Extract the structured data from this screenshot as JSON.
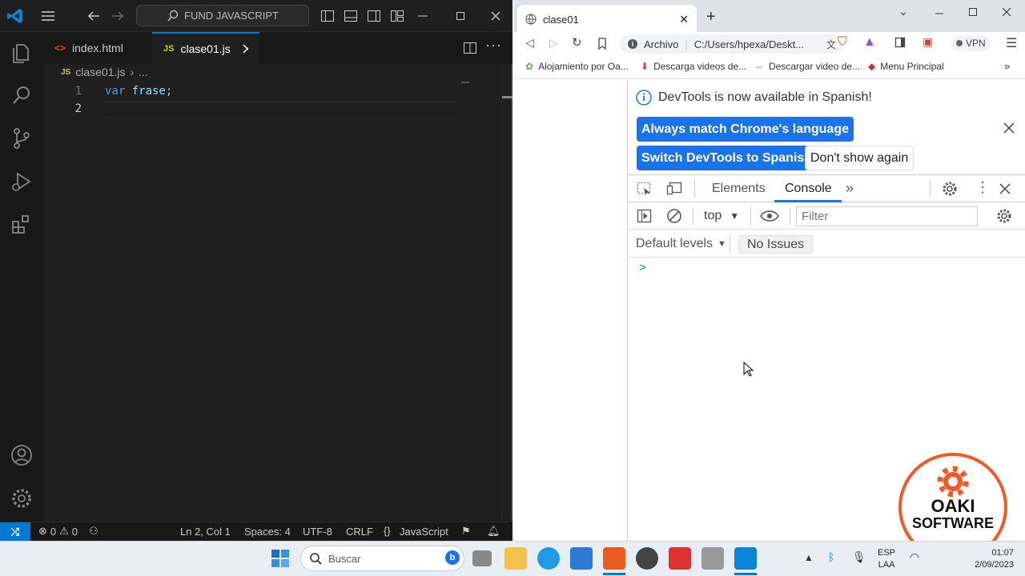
{
  "vscode": {
    "search_label": "FUND JAVASCRIPT",
    "tabs": [
      {
        "label": "index.html",
        "icon": "html-icon"
      },
      {
        "label": "clase01.js",
        "icon": "js-icon",
        "active": true
      }
    ],
    "breadcrumb": {
      "file": "clase01.js",
      "more": "...",
      "js_badge": "JS"
    },
    "lines": [
      {
        "num": "1",
        "code": "var frase;"
      },
      {
        "num": "2",
        "code": ""
      }
    ],
    "status": {
      "errors": "0",
      "warnings": "0",
      "position": "Ln 2, Col 1",
      "spaces": "Spaces: 4",
      "encoding": "UTF-8",
      "eol": "CRLF",
      "lang_icon": "{}",
      "language": "JavaScript"
    }
  },
  "chrome": {
    "tab_title": "clase01",
    "url_prefix": "Archivo",
    "url": "C:/Users/hpexa/Deskt...",
    "vpn": "VPN",
    "bookmarks": [
      "Alojamiento por Oa...",
      "Descarga videos de...",
      "Descargar video de...",
      "Menu Principal"
    ],
    "devtools": {
      "notice": "DevTools is now available in Spanish!",
      "btn_match": "Always match Chrome's language",
      "btn_switch": "Switch DevTools to Spanish",
      "btn_dont_show": "Don't show again",
      "tabs": [
        "Elements",
        "Console"
      ],
      "context": "top",
      "filter_placeholder": "Filter",
      "levels": "Default levels",
      "issues": "No Issues",
      "prompt": ">"
    }
  },
  "taskbar": {
    "search_placeholder": "Buscar",
    "lang_top": "ESP",
    "lang_bottom": "LAA",
    "time": "01:07",
    "date": "2/09/2023"
  },
  "watermark": {
    "line1": "OAKI",
    "line2": "SOFTWARE"
  },
  "colors": {
    "vs_bg": "#1f1f1f",
    "accent": "#0078d4",
    "chrome_blue": "#1a73e8",
    "logo_orange": "#f15a24"
  }
}
